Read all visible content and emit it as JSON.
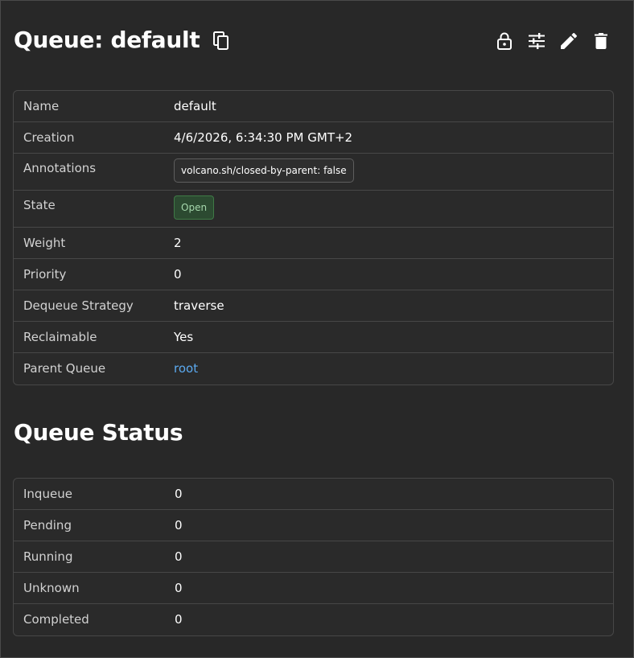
{
  "header": {
    "title": "Queue: default",
    "icons": [
      "copy-icon",
      "lock-icon",
      "tune-icon",
      "edit-icon",
      "delete-icon"
    ]
  },
  "metadata": {
    "rows": [
      {
        "label": "Name",
        "value": "default"
      },
      {
        "label": "Creation",
        "value": "4/6/2026, 6:34:30 PM GMT+2"
      },
      {
        "label": "Annotations",
        "value": "volcano.sh/closed-by-parent: false"
      },
      {
        "label": "State",
        "value": "Open"
      },
      {
        "label": "Weight",
        "value": "2"
      },
      {
        "label": "Priority",
        "value": "0"
      },
      {
        "label": "Dequeue Strategy",
        "value": "traverse"
      },
      {
        "label": "Reclaimable",
        "value": "Yes"
      },
      {
        "label": "Parent Queue",
        "value": "root"
      }
    ]
  },
  "queue_status": {
    "title": "Queue Status",
    "rows": [
      {
        "label": "Inqueue",
        "value": "0"
      },
      {
        "label": "Pending",
        "value": "0"
      },
      {
        "label": "Running",
        "value": "0"
      },
      {
        "label": "Unknown",
        "value": "0"
      },
      {
        "label": "Completed",
        "value": "0"
      }
    ]
  },
  "colors": {
    "background": "#282828",
    "border": "#474747",
    "link": "#5ba9ef",
    "status_open_bg": "#2c4a31",
    "status_open_text": "#a6d8ad"
  }
}
